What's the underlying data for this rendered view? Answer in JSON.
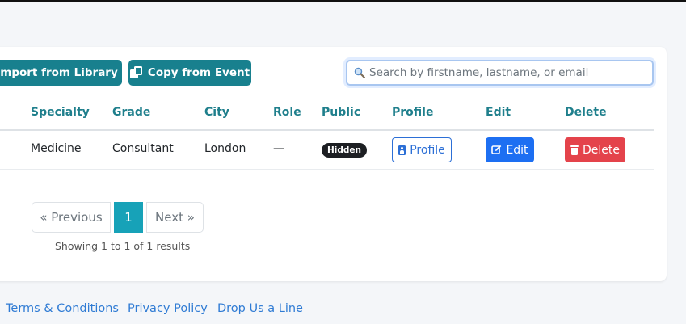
{
  "toolbar": {
    "import_label": "Import from Library",
    "copy_label": "Copy from Event"
  },
  "search": {
    "placeholder": "Search by firstname, lastname, or email",
    "value": ""
  },
  "table": {
    "headers": {
      "specialty": "Specialty",
      "grade": "Grade",
      "city": "City",
      "role": "Role",
      "public": "Public",
      "profile": "Profile",
      "edit": "Edit",
      "delete": "Delete"
    },
    "rows": [
      {
        "specialty": "Medicine",
        "grade": "Consultant",
        "city": "London",
        "role": "—",
        "public_badge": "Hidden",
        "profile_button": "Profile",
        "edit_button": "Edit",
        "delete_button": "Delete"
      }
    ]
  },
  "pagination": {
    "previous": "« Previous",
    "current_page": "1",
    "next": "Next »",
    "summary": "Showing 1 to 1 of 1 results"
  },
  "footer": {
    "links": [
      "Terms & Conditions",
      "Privacy Policy",
      "Drop Us a Line"
    ]
  },
  "colors": {
    "teal_button": "#18808e",
    "header_text": "#1f7f8c",
    "primary": "#1d6ff2",
    "danger": "#e4434b",
    "active_page": "#17a2b8",
    "link": "#2f7bd4"
  },
  "icons": {
    "copy": "copy-icon",
    "search": "search-icon",
    "profile": "id-badge-icon",
    "edit": "edit-icon",
    "delete": "trash-icon"
  }
}
